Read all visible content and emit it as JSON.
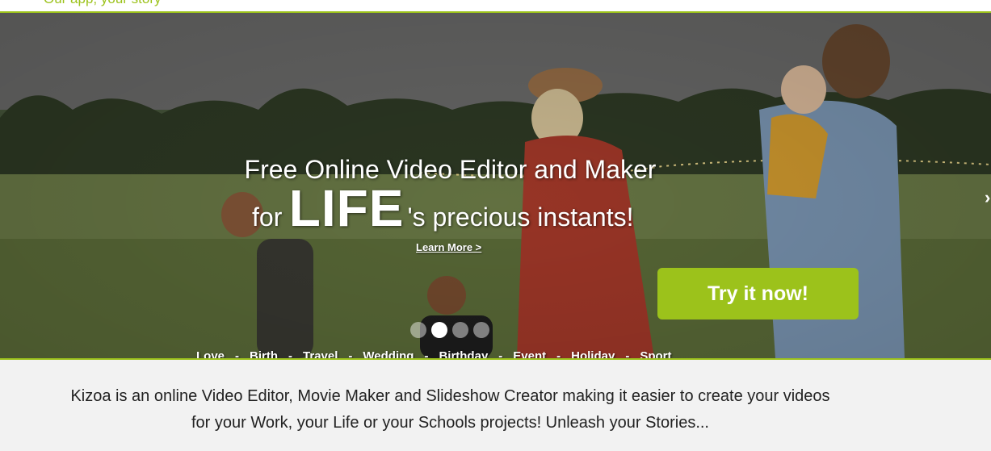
{
  "header": {
    "tagline": "Our app, your story"
  },
  "hero": {
    "headline_line1": "Free Online Video Editor and Maker",
    "headline_pre": "for",
    "headline_big": "LIFE",
    "headline_post": "'s precious instants!",
    "learn_more": "Learn More >",
    "cta": "Try it now!",
    "slides": {
      "count": 4,
      "active": 2
    },
    "categories": [
      "Love",
      "Birth",
      "Travel",
      "Wedding",
      "Birthday",
      "Event",
      "Holiday",
      "Sport"
    ],
    "separator": "-",
    "next_arrow": "›"
  },
  "intro": {
    "line1": "Kizoa is an online Video Editor, Movie Maker and Slideshow Creator making it easier to create your videos",
    "line2": "for your Work, your Life or your Schools projects! Unleash your Stories..."
  },
  "colors": {
    "accent": "#9cc21b",
    "text": "#222222",
    "background": "#f2f2f2"
  }
}
